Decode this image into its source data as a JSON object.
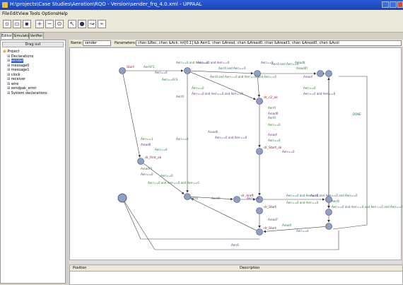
{
  "window": {
    "title": "H:\\projects\\Case Studies\\Aeration\\RQO - Version\\sender_frq_4.0.xml - UPPAAL"
  },
  "menu": [
    "File",
    "Edit",
    "View",
    "Tools",
    "Options",
    "Help"
  ],
  "tabs": [
    "Editor",
    "Simulator",
    "Verifier"
  ],
  "tree": {
    "header": "Drag out",
    "items": [
      {
        "label": "Project",
        "depth": 0
      },
      {
        "label": "Declarations",
        "depth": 1
      },
      {
        "label": "sender",
        "depth": 1,
        "selected": true
      },
      {
        "label": "message0",
        "depth": 1
      },
      {
        "label": "message1",
        "depth": 1
      },
      {
        "label": "clock",
        "depth": 1
      },
      {
        "label": "receiver",
        "depth": 1
      },
      {
        "label": "wire",
        "depth": 1
      },
      {
        "label": "sendpak_error",
        "depth": 1
      },
      {
        "label": "System declarations",
        "depth": 1
      }
    ]
  },
  "template": {
    "name_label": "Name:",
    "name_value": "sender",
    "params_label": "Parameters:",
    "params_value": "chan &Rec, chan &Ack, int[0,1] &b Aerr1, chan &Aread, chan &Aread0, chan &Aread1, chan &Aread0, chan &Acol"
  },
  "bottom": {
    "position": "Position",
    "description": "Description"
  },
  "graph": {
    "states": [
      {
        "id": "s_start",
        "label": "Start"
      },
      {
        "id": "s_top2",
        "label": ""
      },
      {
        "id": "s_top3",
        "label": ""
      },
      {
        "id": "s_top4",
        "label": ""
      },
      {
        "id": "s_top5",
        "label": ""
      },
      {
        "id": "s_first",
        "label": "dr_first_ok"
      },
      {
        "id": "s_c2",
        "label": "dr_c2_ok"
      },
      {
        "id": "s_wait",
        "label": "dr_Start_ok"
      },
      {
        "id": "s_bot1",
        "label": ""
      },
      {
        "id": "s_draft",
        "label": "dr_draft"
      },
      {
        "id": "s_mid3",
        "label": ""
      },
      {
        "id": "s_start2",
        "label": "dr_Start"
      },
      {
        "id": "s_start3",
        "label": "dr_Start"
      },
      {
        "id": "s_bot4",
        "label": ""
      },
      {
        "id": "s_right",
        "label": ""
      },
      {
        "id": "s_bot5",
        "label": ""
      }
    ],
    "labels": [
      "Aerr0?1",
      "Aerr==0",
      "Aerr==0?3",
      "Aerr==0 and Aerr==0",
      "Aerr==0 and Aerr==0",
      "Aerr0 and Aerr==0",
      "Aerr0 and Aerr==0 and Aerr==0 and Aerr==0",
      "Aerr==0",
      "Aread0",
      "Aread0?",
      "Aread!",
      "Aerr0 and Aerr==0",
      "Aerr==0",
      "Aerr==0 and Aerr==0 and Aerr==0",
      "Aerr0",
      "Aerr==0",
      "Aerr==0 and Aerr==0",
      "DONE",
      "Aread0",
      "Aerr==0 and Aerr==0",
      "Aerr==0",
      "Aerr==1",
      "Aread0",
      "Aerr==0",
      "Aread?1",
      "Aerr==0",
      "Aerr==0",
      "Aerr==0 and Aerr==0 and Aerr==0",
      "Aread!",
      "Aerr==0",
      "Aerr0",
      "Aread0",
      "Aerr0",
      "Aerr==0",
      "Aerr==0",
      "Aerr0",
      "Aerr0!",
      "Aerr==0",
      "Aerr==0 and Aerr==0 and Aerr==0 and Aerr==0",
      "Aerr==0 and Aerr==0",
      "Aerr0",
      "Aerr0",
      "Aerr==0 and Aerr==0 and Aerr==0 and Aerr==0",
      "Aread?",
      "Aread!",
      "Aerr==0",
      "Aerr0"
    ]
  }
}
